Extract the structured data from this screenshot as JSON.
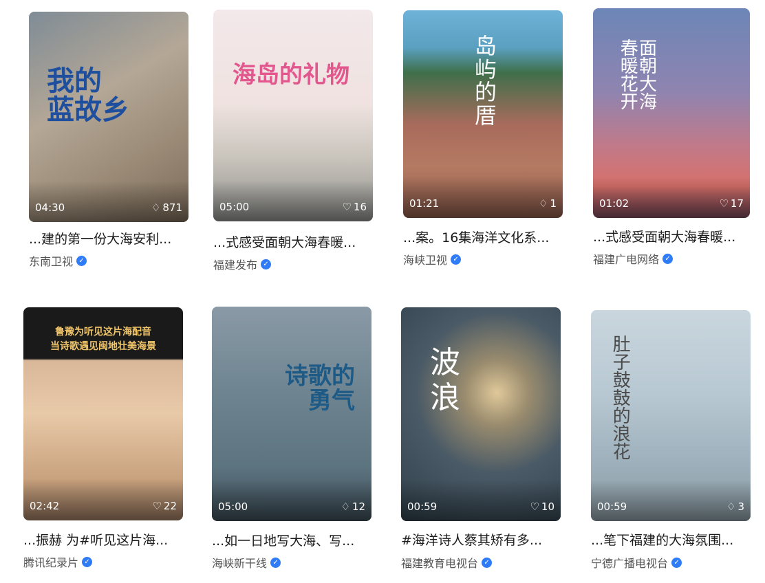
{
  "videos": [
    {
      "overlay": "我的\n蓝故乡",
      "duration": "04:30",
      "likes": "871",
      "like_icon": "thumb-up-icon",
      "title": "...建的第一份大海安利...",
      "author": "东南卫视"
    },
    {
      "overlay": "海岛的礼物",
      "duration": "05:00",
      "likes": "16",
      "like_icon": "heart-icon",
      "title": "...式感受面朝大海春暖...",
      "author": "福建发布"
    },
    {
      "overlay": "岛\n屿\n的\n厝",
      "duration": "01:21",
      "likes": "1",
      "like_icon": "thumb-up-icon",
      "title": "...案。16集海洋文化系...",
      "author": "海峡卫视"
    },
    {
      "overlay": "面朝大海\n春暖花开",
      "duration": "01:02",
      "likes": "17",
      "like_icon": "heart-icon",
      "title": "...式感受面朝大海春暖...",
      "author": "福建广电网络"
    },
    {
      "overlay": "鲁豫为听见这片海配音\n当诗歌遇见闽地壮美海景",
      "duration": "02:42",
      "likes": "22",
      "like_icon": "heart-icon",
      "title": "...振赫 为#听见这片海...",
      "author": "腾讯纪录片"
    },
    {
      "overlay": "诗歌的\n勇气",
      "duration": "05:00",
      "likes": "12",
      "like_icon": "thumb-up-icon",
      "title": "...如一日地写大海、写...",
      "author": "海峡新干线"
    },
    {
      "overlay": "波\n浪",
      "duration": "00:59",
      "likes": "10",
      "like_icon": "heart-icon",
      "title": "#海洋诗人蔡其矫有多...",
      "author": "福建教育电视台"
    },
    {
      "overlay": "肚子鼓鼓的浪花",
      "duration": "00:59",
      "likes": "3",
      "like_icon": "thumb-up-icon",
      "title": "...笔下福建的大海氛围...",
      "author": "宁德广播电视台"
    }
  ],
  "colors": {
    "verified_badge": "#2f7cf6",
    "title_text": "#1c1c1c",
    "author_text": "#555555"
  }
}
